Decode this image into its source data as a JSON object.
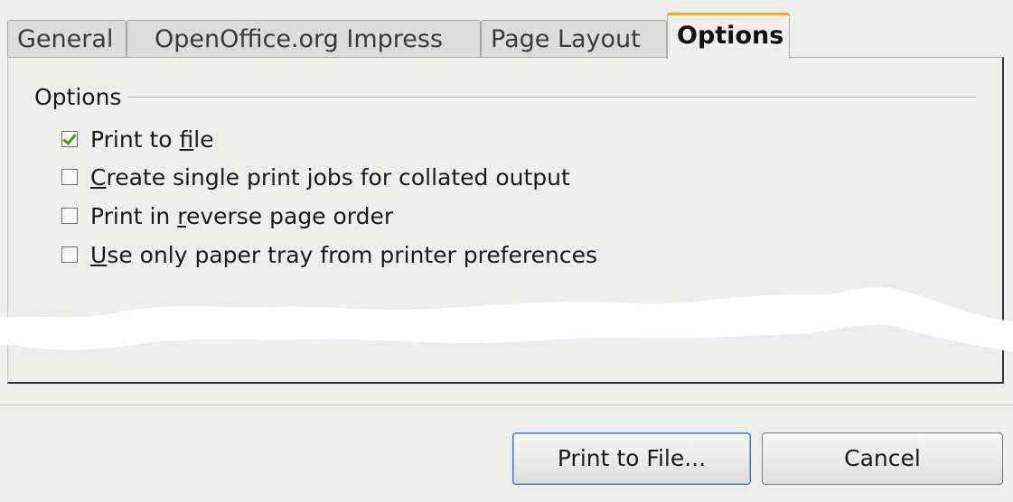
{
  "tabs": [
    {
      "label": "General"
    },
    {
      "label": "OpenOffice.org Impress"
    },
    {
      "label": "Page Layout"
    },
    {
      "label": "Options",
      "active": true
    }
  ],
  "options_group": {
    "title": "Options",
    "items": [
      {
        "pre": "Print to ",
        "mnemonic": "f",
        "post": "ile",
        "checked": true
      },
      {
        "pre": "",
        "mnemonic": "C",
        "post": "reate single print jobs for collated output",
        "checked": false
      },
      {
        "pre": "Print in ",
        "mnemonic": "r",
        "post": "everse page order",
        "checked": false
      },
      {
        "pre": "",
        "mnemonic": "U",
        "post": "se only paper tray from printer preferences",
        "checked": false
      }
    ]
  },
  "buttons": {
    "print_to_file": "Print to File...",
    "cancel": "Cancel"
  },
  "colors": {
    "active_tab_accent": "#f5a623",
    "checkmark": "#4e9a06"
  }
}
